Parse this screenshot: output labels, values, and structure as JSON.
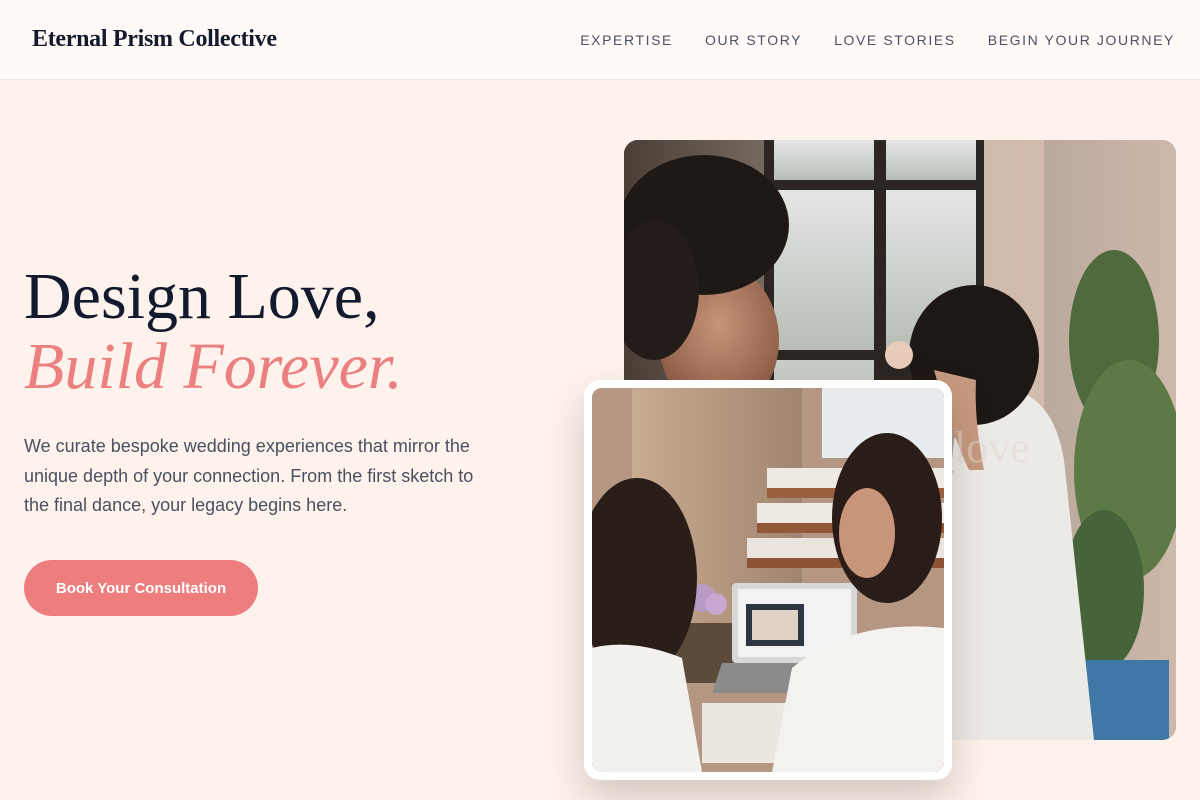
{
  "header": {
    "logo": "Eternal Prism Collective",
    "nav": [
      {
        "label": "EXPERTISE"
      },
      {
        "label": "OUR STORY"
      },
      {
        "label": "LOVE STORIES"
      },
      {
        "label": "BEGIN YOUR JOURNEY"
      }
    ]
  },
  "hero": {
    "title_line1": "Design Love,",
    "title_line2": "Build Forever.",
    "description": "We curate bespoke wedding experiences that mirror the unique depth of your connection. From the first sketch to the final dance, your legacy begins here.",
    "cta_label": "Book Your Consultation"
  },
  "colors": {
    "background": "#fdf3ec",
    "header_bg": "#fffaf7",
    "accent": "#ec8080",
    "button": "#ee7d7d",
    "heading": "#141a2e",
    "body_text": "#4a5060"
  }
}
